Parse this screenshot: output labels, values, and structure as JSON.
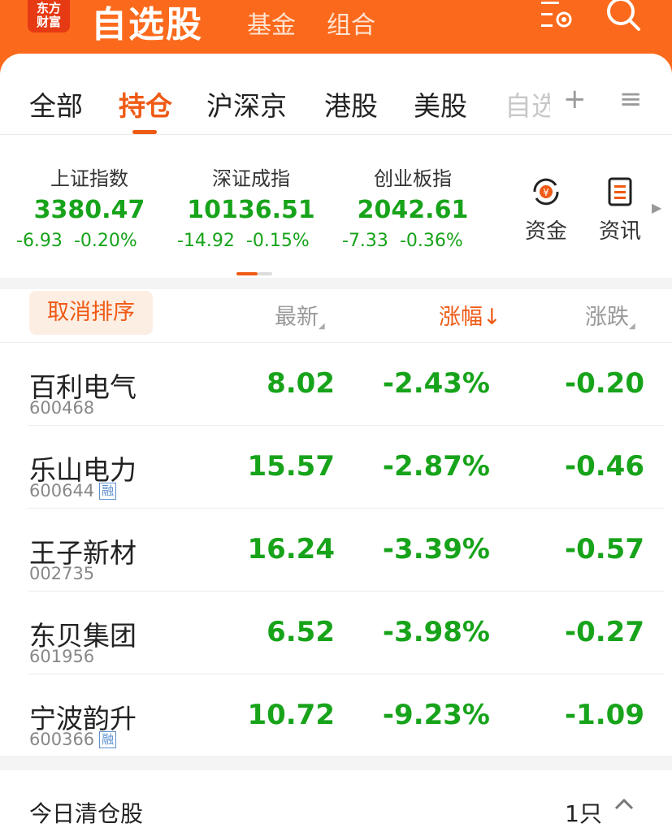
{
  "header": {
    "logo_line1": "东方",
    "logo_line2": "财富",
    "title": "自选股",
    "nav": [
      "基金",
      "组合"
    ],
    "icons": [
      "settings-list-icon",
      "search-icon"
    ],
    "brand_color": "#fb6a1c"
  },
  "tabs": {
    "items": [
      "全部",
      "持仓",
      "沪深京",
      "港股",
      "美股",
      "自选"
    ],
    "active": "持仓",
    "add_icon": "+",
    "menu_icon": "≡"
  },
  "indices": [
    {
      "name": "上证指数",
      "value": "3380.47",
      "change": "-6.93",
      "pct": "-0.20%"
    },
    {
      "name": "深证成指",
      "value": "10136.51",
      "change": "-14.92",
      "pct": "-0.15%"
    },
    {
      "name": "创业板指",
      "value": "2042.61",
      "change": "-7.33",
      "pct": "-0.36%"
    }
  ],
  "tools": {
    "fund": {
      "label": "资金",
      "icon": "fund-flow-icon"
    },
    "news": {
      "label": "资讯",
      "icon": "news-icon"
    }
  },
  "sort": {
    "cancel": "取消排序",
    "col_latest": "最新",
    "col_pct": "涨幅",
    "col_chg": "涨跌",
    "pct_arrow": "↓"
  },
  "stocks": [
    {
      "name": "百利电气",
      "code": "600468",
      "margin": "",
      "price": "8.02",
      "pct": "-2.43%",
      "chg": "-0.20"
    },
    {
      "name": "乐山电力",
      "code": "600644",
      "margin": "融",
      "price": "15.57",
      "pct": "-2.87%",
      "chg": "-0.46"
    },
    {
      "name": "王子新材",
      "code": "002735",
      "margin": "",
      "price": "16.24",
      "pct": "-3.39%",
      "chg": "-0.57"
    },
    {
      "name": "东贝集团",
      "code": "601956",
      "margin": "",
      "price": "6.52",
      "pct": "-3.98%",
      "chg": "-0.27"
    },
    {
      "name": "宁波韵升",
      "code": "600366",
      "margin": "融",
      "price": "10.72",
      "pct": "-9.23%",
      "chg": "-1.09"
    }
  ],
  "cleared": {
    "label": "今日清仓股",
    "count": "1只"
  },
  "colors": {
    "down": "#17a31a",
    "accent": "#ef5a14"
  }
}
